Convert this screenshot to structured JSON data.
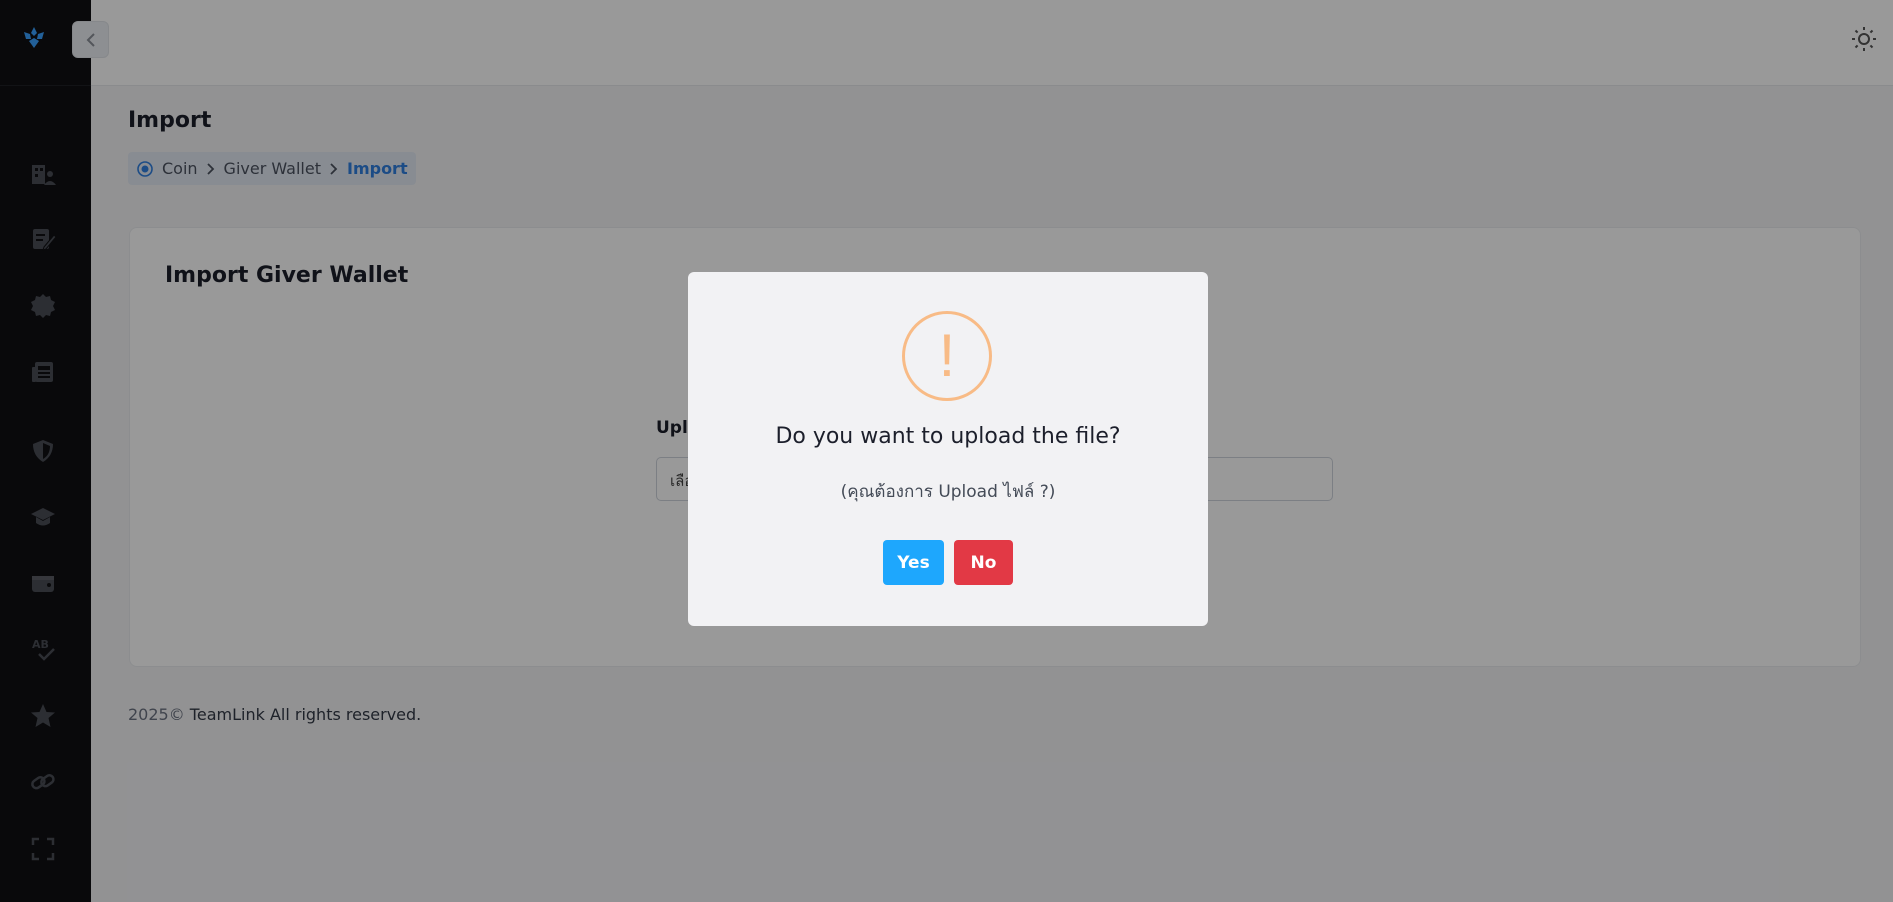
{
  "header": {
    "theme_icon": "sun-icon",
    "avatar": "user-avatar"
  },
  "sidebar": {
    "logo": "teamlink-logo",
    "items": [
      {
        "icon": "building-users-icon"
      },
      {
        "icon": "edit-document-icon"
      },
      {
        "icon": "badge-seal-icon"
      },
      {
        "icon": "newspaper-icon"
      },
      {
        "icon": "shield-icon"
      },
      {
        "icon": "graduation-cap-icon"
      },
      {
        "icon": "wallet-icon"
      },
      {
        "icon": "spell-check-icon"
      },
      {
        "icon": "star-icon"
      },
      {
        "icon": "link-icon"
      },
      {
        "icon": "fullscreen-icon"
      }
    ]
  },
  "page": {
    "title": "Import",
    "breadcrumb": [
      "Coin",
      "Giver Wallet",
      "Import"
    ]
  },
  "card": {
    "title": "Import Giver Wallet",
    "upload_label": "Uplo",
    "upload_value": "เลือ"
  },
  "footer": {
    "year": "2025©",
    "text": " TeamLink All rights reserved."
  },
  "modal": {
    "icon": "!",
    "title": "Do you want to upload the file?",
    "subtitle": "(คุณต้องการ Upload ไฟล์ ?)",
    "yes_label": "Yes",
    "no_label": "No"
  },
  "colors": {
    "sidebar_bg": "#0f1013",
    "accent": "#2f7fe0",
    "yes": "#1ea7fd",
    "no": "#e23945",
    "warning": "#f8bb86"
  }
}
